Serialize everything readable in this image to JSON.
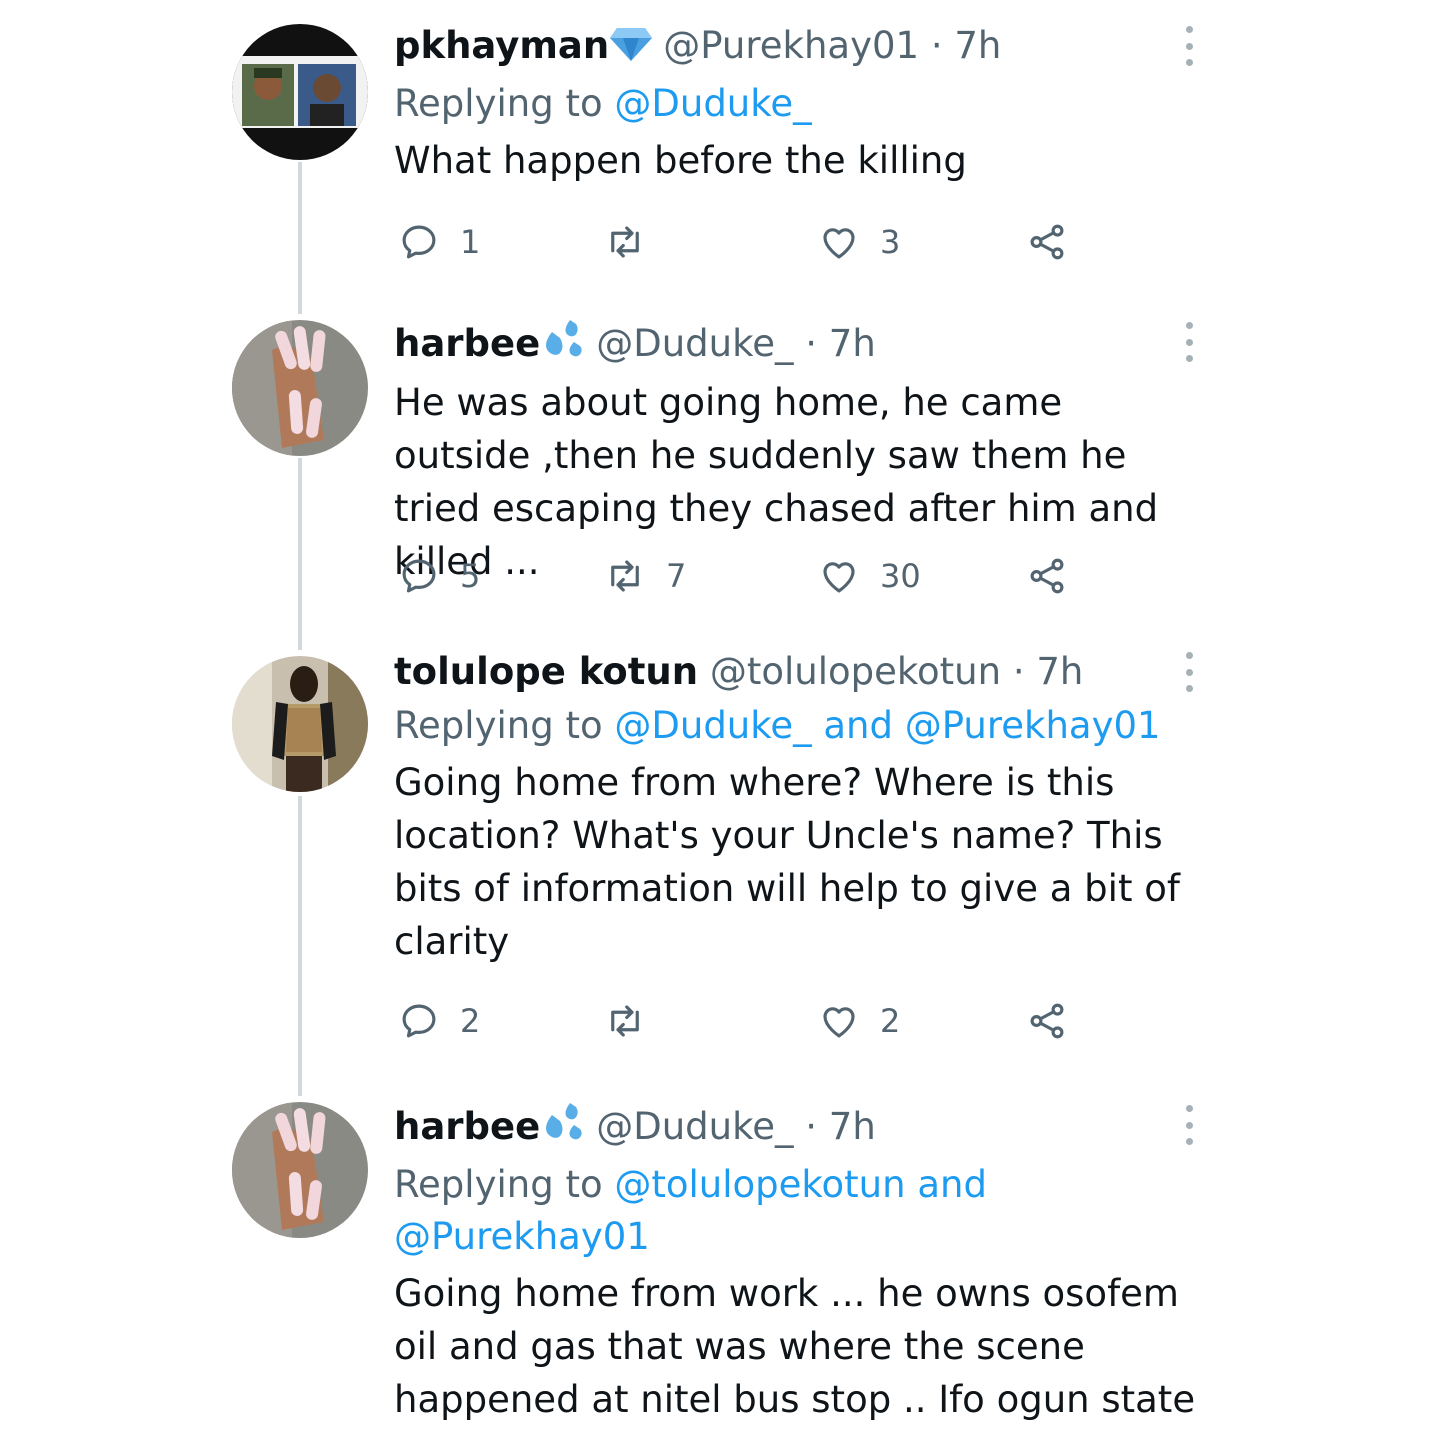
{
  "tweets": [
    {
      "name": "pkhayman",
      "handle": "@Purekhay01",
      "dot": "·",
      "time": "7h",
      "replying_prefix": "Replying to",
      "replying_to": "@Duduke_",
      "text": "What happen before the killing",
      "replies": "1",
      "retweets": "",
      "likes": "3",
      "badge": "diamond-icon"
    },
    {
      "name": "harbee",
      "handle": "@Duduke_",
      "dot": "·",
      "time": "7h",
      "text": "He was about going home, he came outside ,then he suddenly saw them he tried escaping they chased after him and killed ...",
      "replies": "5",
      "retweets": "7",
      "likes": "30",
      "badge": "sweat-droplets-icon"
    },
    {
      "name": "tolulope kotun",
      "handle": "@tolulopekotun",
      "dot": "·",
      "time": "7h",
      "replying_prefix": "Replying to",
      "replying_to": "@Duduke_ and @Purekhay01",
      "text": "Going home from where? Where is this location? What's your Uncle's name? This bits of information will help to give a bit of clarity",
      "replies": "2",
      "retweets": "",
      "likes": "2"
    },
    {
      "name": "harbee",
      "handle": "@Duduke_",
      "dot": "·",
      "time": "7h",
      "replying_prefix": "Replying to",
      "replying_to": "@tolulopekotun and @Purekhay01",
      "text": "Going home from work ... he owns osofem oil and gas that was where the scene happened at nitel bus stop .. Ifo ogun state",
      "badge": "sweat-droplets-icon"
    }
  ],
  "colors": {
    "link": "#1d9bf0",
    "muted": "#536471",
    "thread_line": "#cfd9de",
    "text": "#0f1419"
  }
}
